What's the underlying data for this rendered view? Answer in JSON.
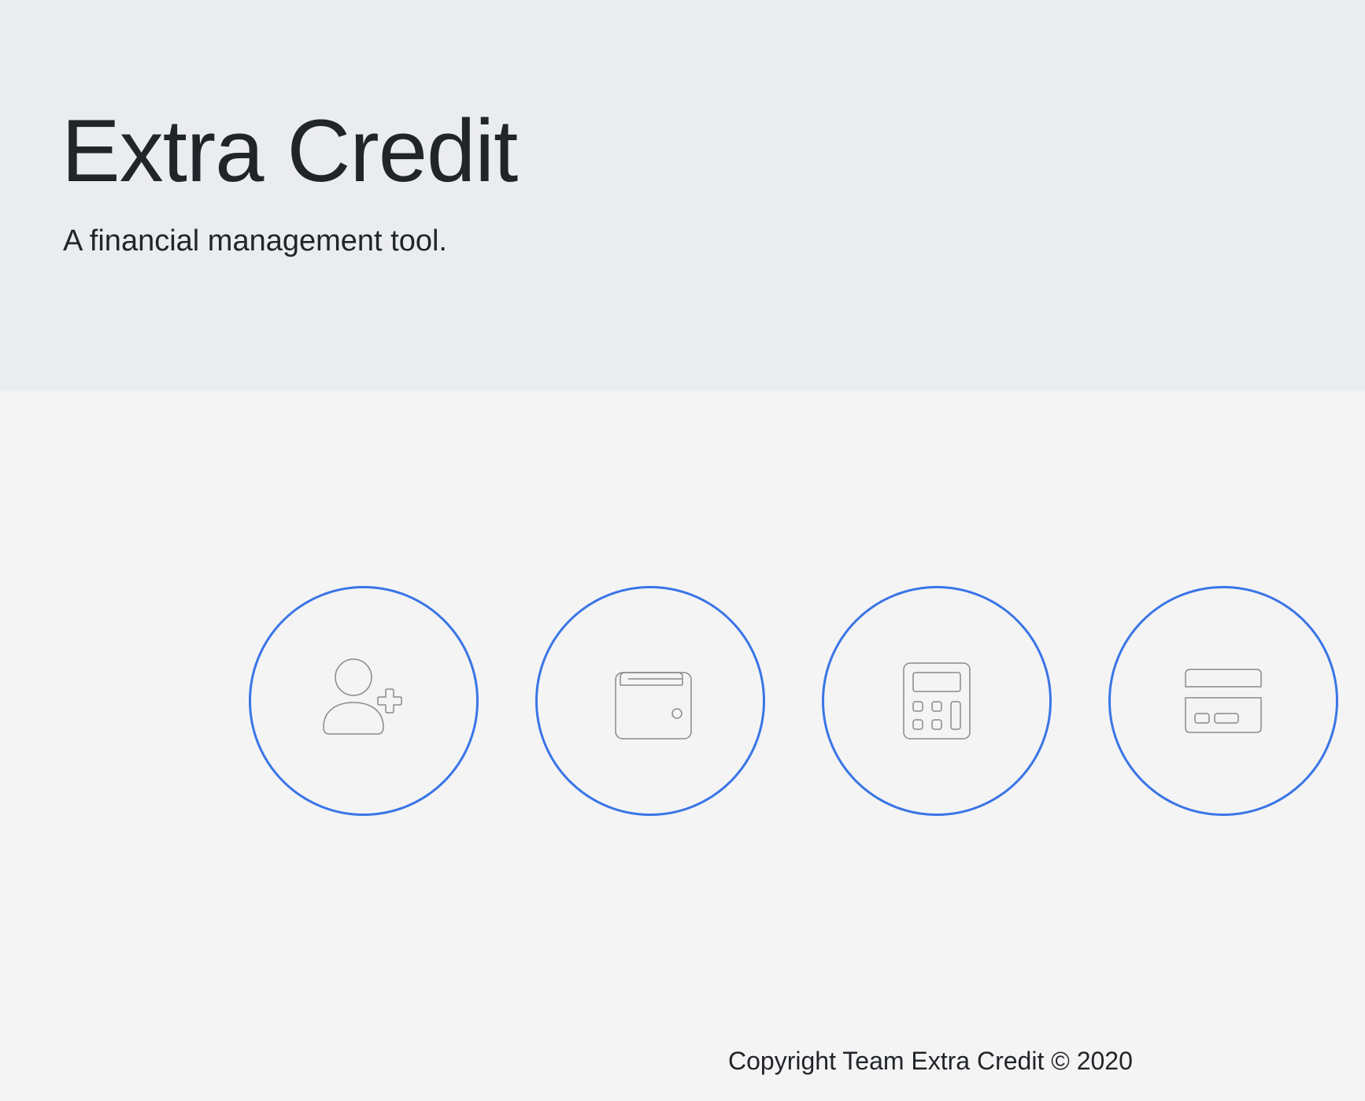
{
  "hero": {
    "title": "Extra Credit",
    "subtitle": "A financial management tool."
  },
  "actions": [
    {
      "icon": "person-plus-icon"
    },
    {
      "icon": "wallet-icon"
    },
    {
      "icon": "calculator-icon"
    },
    {
      "icon": "credit-card-icon"
    }
  ],
  "colors": {
    "accent": "#3a75e6",
    "hero_background": "#ebecf0",
    "page_background": "#f4f4f5",
    "icon_stroke": "#8a8a8a",
    "text": "#212529"
  },
  "footer": {
    "copyright": "Copyright Team Extra Credit © 2020"
  }
}
